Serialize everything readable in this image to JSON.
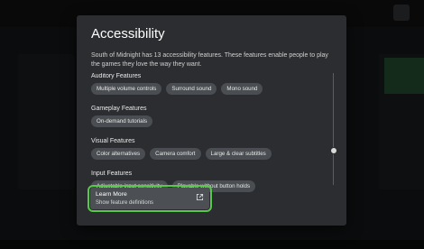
{
  "dialog": {
    "title": "Accessibility",
    "description": "South of Midnight has 13 accessibility features. These features enable people to play the games they love the way they want.",
    "sections": [
      {
        "title": "Auditory Features",
        "chips": [
          "Multiple volume controls",
          "Surround sound",
          "Mono sound"
        ]
      },
      {
        "title": "Gameplay Features",
        "chips": [
          "On-demand tutorials"
        ]
      },
      {
        "title": "Visual Features",
        "chips": [
          "Color alternatives",
          "Camera comfort",
          "Large & clear subtitles"
        ]
      },
      {
        "title": "Input Features",
        "chips": [
          "Adjustable input sensitivity",
          "Playable without button holds"
        ]
      }
    ],
    "learn_more": {
      "title": "Learn More",
      "subtitle": "Show feature definitions",
      "icon": "open-external-icon"
    }
  },
  "colors": {
    "focus": "#57c84a",
    "modal_bg": "#2b2d30",
    "chip_bg": "#4a4d51"
  }
}
